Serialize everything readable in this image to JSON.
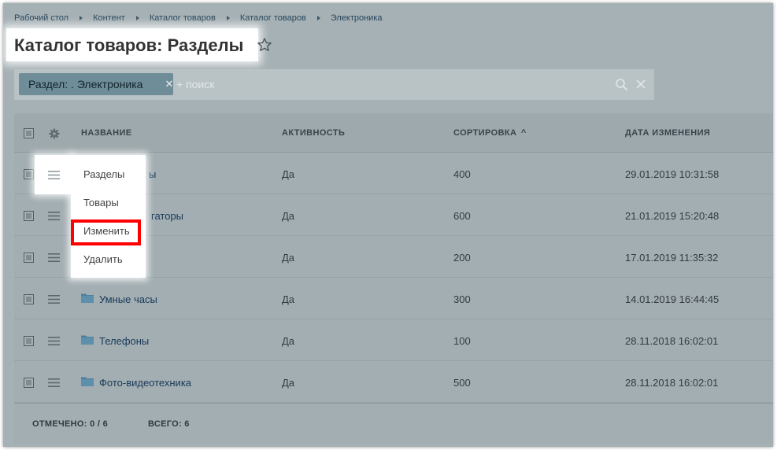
{
  "breadcrumbs": [
    "Рабочий стол",
    "Контент",
    "Каталог товаров",
    "Каталог товаров",
    "Электроника"
  ],
  "page_title": "Каталог товаров: Разделы",
  "filter": {
    "tag_label": "Раздел: . Электроника",
    "placeholder": "+ поиск"
  },
  "grid": {
    "columns": {
      "name": "НАЗВАНИЕ",
      "active": "АКТИВНОСТЬ",
      "sort": "СОРТИРОВКА",
      "date": "ДАТА ИЗМЕНЕНИЯ"
    },
    "sort_indicator": "^",
    "rows": [
      {
        "name": "ы",
        "active": "Да",
        "sort": "400",
        "date": "29.01.2019 10:31:58"
      },
      {
        "name": "гаторы",
        "active": "Да",
        "sort": "600",
        "date": "21.01.2019 15:20:48"
      },
      {
        "name": "",
        "active": "Да",
        "sort": "200",
        "date": "17.01.2019 11:35:32"
      },
      {
        "name": "Умные часы",
        "active": "Да",
        "sort": "300",
        "date": "14.01.2019 16:44:45"
      },
      {
        "name": "Телефоны",
        "active": "Да",
        "sort": "100",
        "date": "28.11.2018 16:02:01"
      },
      {
        "name": "Фото-видеотехника",
        "active": "Да",
        "sort": "500",
        "date": "28.11.2018 16:02:01"
      }
    ],
    "footer": {
      "checked_label": "ОТМЕЧЕНО:",
      "checked_value": "0 / 6",
      "total_label": "ВСЕГО:",
      "total_value": "6"
    }
  },
  "context_menu": {
    "items": [
      "Разделы",
      "Товары",
      "Изменить",
      "Удалить"
    ],
    "highlighted_item": "Изменить"
  },
  "colors": {
    "overlay": "#a6b1b5",
    "link": "#183957",
    "highlight": "#ff0000"
  }
}
